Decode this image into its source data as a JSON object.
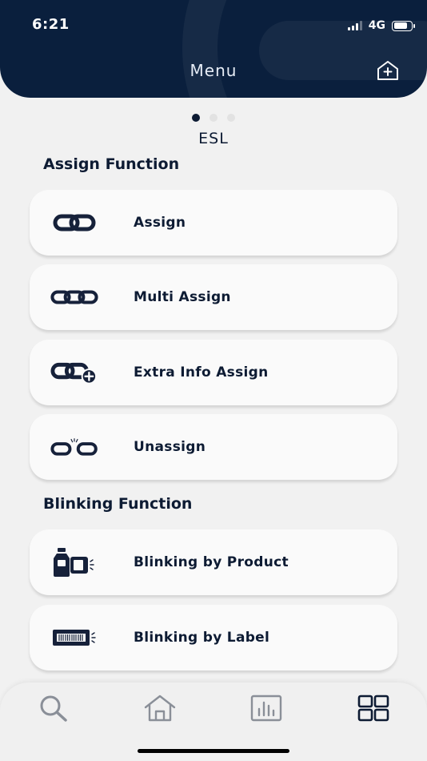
{
  "status_bar": {
    "time": "6:21",
    "network": "4G"
  },
  "header": {
    "title": "Menu"
  },
  "pager": {
    "pages": 3,
    "active": 0
  },
  "section": {
    "label": "ESL"
  },
  "assign_group": {
    "title": "Assign Function",
    "items": [
      {
        "label": "Assign",
        "icon": "link-icon"
      },
      {
        "label": "Multi Assign",
        "icon": "multi-link-icon"
      },
      {
        "label": "Extra Info Assign",
        "icon": "link-plus-icon"
      },
      {
        "label": "Unassign",
        "icon": "unlink-icon"
      }
    ]
  },
  "blinking_group": {
    "title": "Blinking Function",
    "items": [
      {
        "label": "Blinking by Product",
        "icon": "product-blink-icon"
      },
      {
        "label": "Blinking by Label",
        "icon": "label-blink-icon"
      }
    ]
  },
  "bottom_nav": {
    "items": [
      "search-icon",
      "home-icon",
      "chart-icon",
      "grid-icon"
    ],
    "active": 3
  },
  "colors": {
    "primary": "#0a1f3d",
    "background": "#f1f1f1",
    "card": "#fafafa",
    "inactive": "#8a8f98"
  }
}
